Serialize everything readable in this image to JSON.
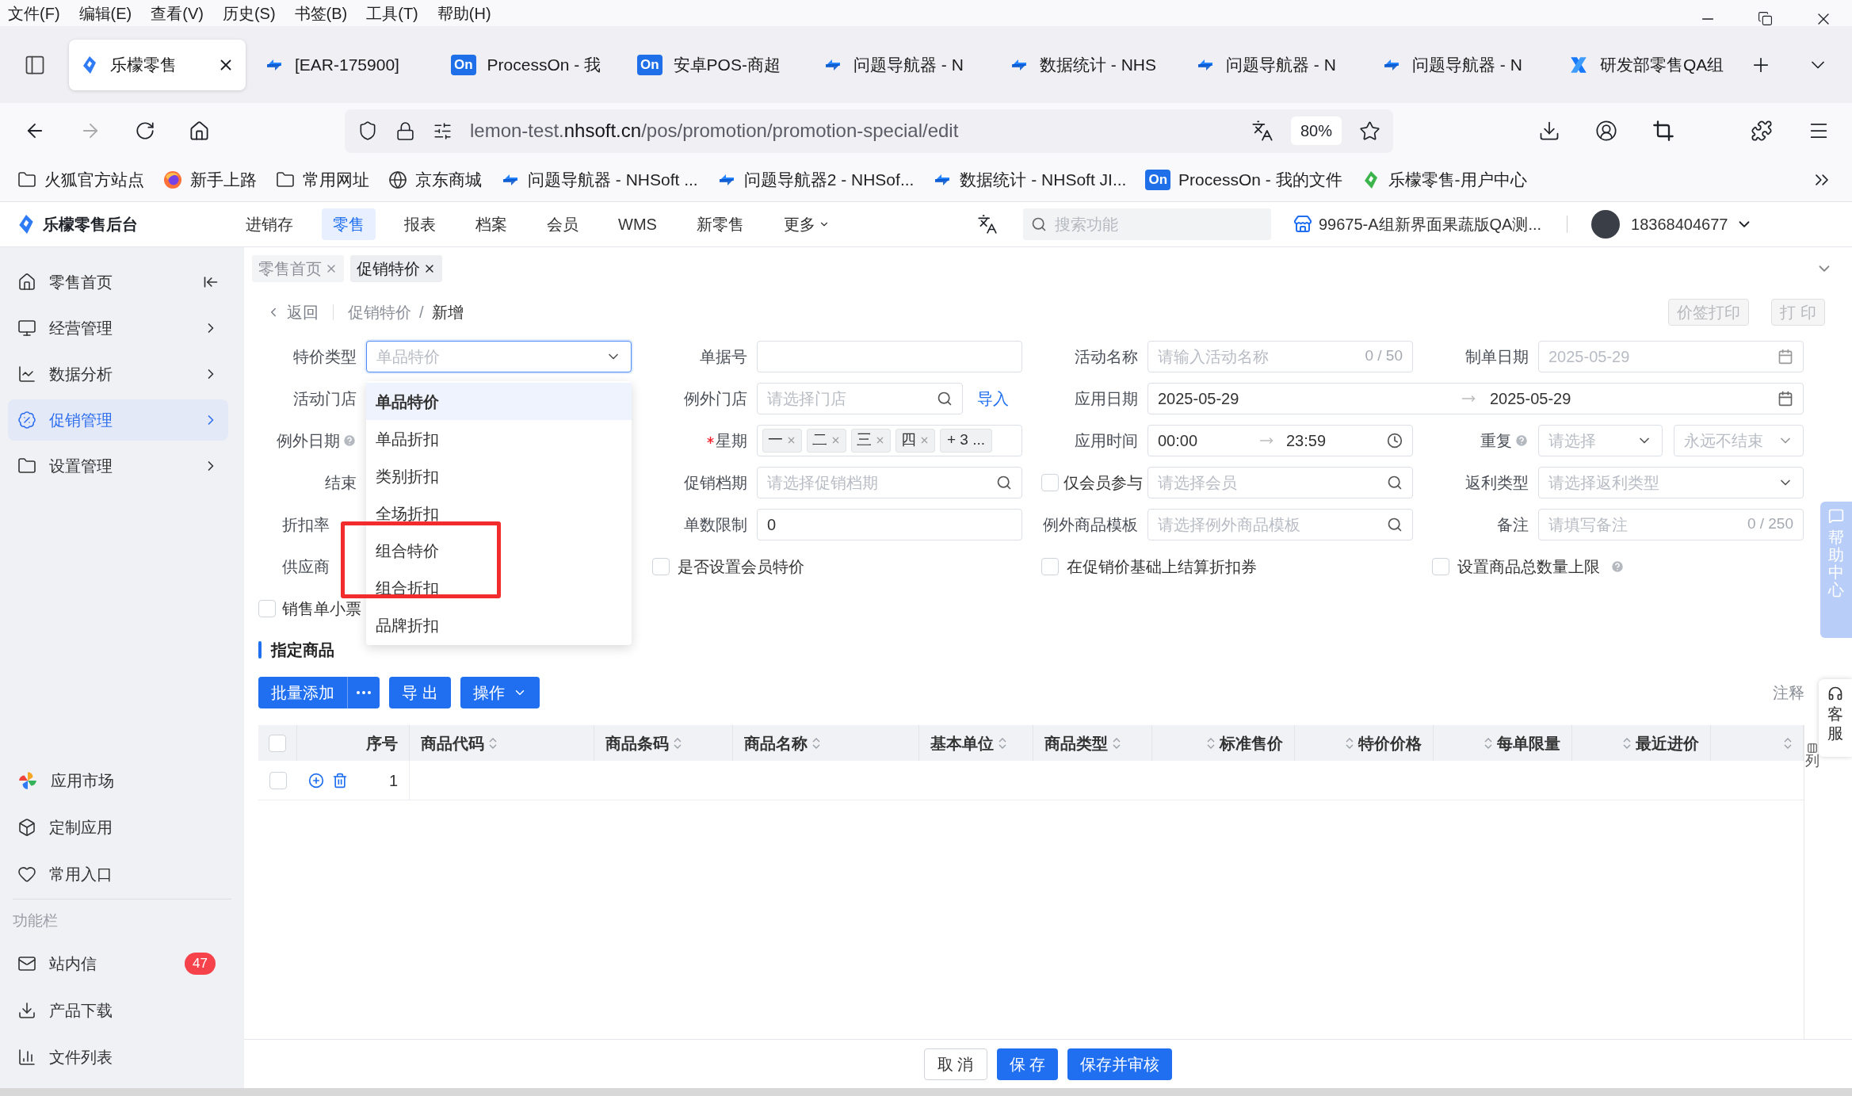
{
  "menu_bar": [
    "文件(F)",
    "编辑(E)",
    "查看(V)",
    "历史(S)",
    "书签(B)",
    "工具(T)",
    "帮助(H)"
  ],
  "browser_tabs": [
    {
      "title": "乐檬零售",
      "kind": "lemon",
      "selected": true
    },
    {
      "title": "[EAR-175900]",
      "kind": "nav",
      "selected": false
    },
    {
      "title": "ProcessOn - 我",
      "kind": "on",
      "badge": "On",
      "selected": false
    },
    {
      "title": "安卓POS-商超",
      "kind": "on",
      "badge": "On",
      "selected": false
    },
    {
      "title": "问题导航器 - N",
      "kind": "nav",
      "selected": false
    },
    {
      "title": "数据统计 - NHS",
      "kind": "nav",
      "selected": false
    },
    {
      "title": "问题导航器 - N",
      "kind": "nav",
      "selected": false
    },
    {
      "title": "问题导航器 - N",
      "kind": "nav",
      "selected": false
    },
    {
      "title": "研发部零售QA组",
      "kind": "x",
      "selected": false
    }
  ],
  "address_bar": {
    "url": "lemon-test.**nhsoft.cn**/pos/promotion/promotion-special/edit",
    "zoom": "80%"
  },
  "bookmarks": [
    {
      "label": "火狐官方站点",
      "kind": "folder"
    },
    {
      "label": "新手上路",
      "kind": "firefox"
    },
    {
      "label": "常用网址",
      "kind": "folder"
    },
    {
      "label": "京东商城",
      "kind": "globe"
    },
    {
      "label": "问题导航器 - NHSoft ...",
      "kind": "nav"
    },
    {
      "label": "问题导航器2 - NHSof...",
      "kind": "nav"
    },
    {
      "label": "数据统计 - NHSoft JI...",
      "kind": "nav"
    },
    {
      "label": "ProcessOn - 我的文件",
      "kind": "on",
      "badge": "On"
    },
    {
      "label": "乐檬零售-用户中心",
      "kind": "leaf"
    }
  ],
  "app_header": {
    "brand": "乐檬零售后台",
    "nav": [
      {
        "label": "进销存",
        "selected": false
      },
      {
        "label": "零售",
        "selected": true
      },
      {
        "label": "报表",
        "selected": false
      },
      {
        "label": "档案",
        "selected": false
      },
      {
        "label": "会员",
        "selected": false
      },
      {
        "label": "WMS",
        "selected": false
      },
      {
        "label": "新零售",
        "selected": false
      }
    ],
    "more": "更多",
    "search_placeholder": "搜索功能",
    "store": "99675-A组新界面果蔬版QA测...",
    "account": "18368404677"
  },
  "sidebar": {
    "items": [
      {
        "label": "零售首页",
        "selected": false
      },
      {
        "label": "经营管理",
        "selected": false
      },
      {
        "label": "数据分析",
        "selected": false
      },
      {
        "label": "促销管理",
        "selected": true
      },
      {
        "label": "设置管理",
        "selected": false
      }
    ],
    "apps": [
      {
        "label": "应用市场"
      },
      {
        "label": "定制应用"
      },
      {
        "label": "常用入口"
      }
    ],
    "section": "功能栏",
    "tools": [
      {
        "label": "站内信",
        "badge": "47"
      },
      {
        "label": "产品下载"
      },
      {
        "label": "文件列表"
      }
    ]
  },
  "page_tabs": [
    {
      "label": "零售首页",
      "selected": false
    },
    {
      "label": "促销特价",
      "selected": true
    }
  ],
  "breadcrumb": {
    "back": "返回",
    "parent": "促销特价",
    "separator": "/",
    "current": "新增"
  },
  "header_actions": [
    {
      "label": "价签打印",
      "disabled": true
    },
    {
      "label": "打 印",
      "disabled": true
    }
  ],
  "form": {
    "special_type": {
      "label": "特价类型",
      "placeholder": "单品特价"
    },
    "doc_no": {
      "label": "单据号"
    },
    "activity_name": {
      "label": "活动名称",
      "placeholder": "请输入活动名称",
      "count": "0 / 50"
    },
    "create_date": {
      "label": "制单日期",
      "placeholder": "2025-05-29"
    },
    "activity_store": {
      "label": "活动门店"
    },
    "exception_store": {
      "label": "例外门店",
      "placeholder": "请选择门店",
      "link": "导入"
    },
    "apply_date": {
      "label": "应用日期",
      "start": "2025-05-29",
      "end": "2025-05-29"
    },
    "exception_date": {
      "label": "例外日期"
    },
    "weekday": {
      "label": "星期",
      "required": true,
      "tags": [
        "一",
        "二",
        "三",
        "四"
      ],
      "more": "+ 3 ..."
    },
    "apply_time": {
      "label": "应用时间",
      "start": "00:00",
      "end": "23:59"
    },
    "repeat": {
      "label": "重复",
      "placeholder": "请选择",
      "end_placeholder": "永远不结束"
    },
    "end": {
      "label": "结束"
    },
    "promo_schedule": {
      "label": "促销档期",
      "placeholder": "请选择促销档期"
    },
    "member_only": {
      "label": "仅会员参与",
      "checked": false,
      "placeholder": "请选择会员"
    },
    "rebate_type": {
      "label": "返利类型",
      "placeholder": "请选择返利类型"
    },
    "discount_rate": {
      "label": "折扣率"
    },
    "order_limit": {
      "label": "单数限制",
      "value": "0"
    },
    "exception_template": {
      "label": "例外商品模板",
      "placeholder": "请选择例外商品模板"
    },
    "remark": {
      "label": "备注",
      "placeholder": "请填写备注",
      "count": "0 / 250"
    },
    "supplier": {
      "label": "供应商"
    },
    "member_price": {
      "label": "是否设置会员特价",
      "checked": false
    },
    "coupon_on_promo": {
      "label": "在促销价基础上结算折扣券",
      "checked": false
    },
    "total_qty_limit": {
      "label": "设置商品总数量上限",
      "checked": false
    },
    "receipt": {
      "label": "销售单小票",
      "checked": false
    }
  },
  "dropdown": {
    "options": [
      {
        "label": "单品特价",
        "selected": true
      },
      {
        "label": "单品折扣",
        "selected": false
      },
      {
        "label": "类别折扣",
        "selected": false
      },
      {
        "label": "全场折扣",
        "selected": false
      },
      {
        "label": "组合特价",
        "selected": false
      },
      {
        "label": "组合折扣",
        "selected": false
      },
      {
        "label": "品牌折扣",
        "selected": false
      }
    ]
  },
  "annotations": [
    {
      "kind": "box"
    }
  ],
  "products": {
    "title": "指定商品",
    "batch_add": "批量添加",
    "export": "导 出",
    "operate": "操作",
    "note": "注释",
    "all_checked": false,
    "columns": [
      {
        "label": "序号",
        "sortable": false
      },
      {
        "label": "商品代码",
        "sortable": true
      },
      {
        "label": "商品条码",
        "sortable": true
      },
      {
        "label": "商品名称",
        "sortable": true
      },
      {
        "label": "基本单位",
        "sortable": true
      },
      {
        "label": "商品类型",
        "sortable": true
      },
      {
        "label": "标准售价",
        "sortable": true
      },
      {
        "label": "特价价格",
        "sortable": true
      },
      {
        "label": "每单限量",
        "sortable": true
      },
      {
        "label": "最近进价",
        "sortable": true
      },
      {
        "sortable": true
      }
    ],
    "rows": [
      {
        "index": "1",
        "checked": false
      }
    ],
    "column_settings": "列"
  },
  "footer": [
    {
      "label": "取 消",
      "kind": "default"
    },
    {
      "label": "保 存",
      "kind": "primary"
    },
    {
      "label": "保存并审核",
      "kind": "primary"
    }
  ],
  "side_widgets": {
    "help": "帮助中心",
    "service": "客服"
  }
}
